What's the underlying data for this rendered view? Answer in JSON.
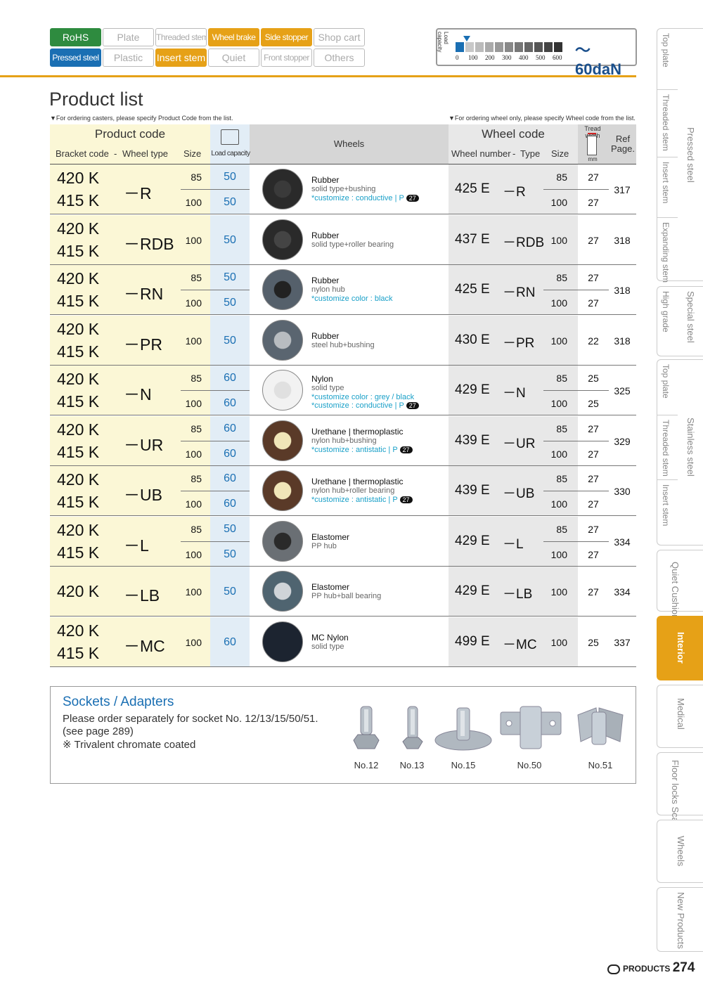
{
  "tags": {
    "row1": [
      "RoHS",
      "Plate",
      "Threaded stem",
      "Wheel brake",
      "Side stopper",
      "Shop cart"
    ],
    "row2": [
      "Pressed steel",
      "Plastic",
      "Insert stem",
      "Quiet",
      "Front stopper",
      "Others"
    ]
  },
  "load_capacity": {
    "label": "Load capacity",
    "scale_labels": [
      "0",
      "100",
      "200",
      "300",
      "400",
      "500",
      "600"
    ],
    "value": "～60daN",
    "level_daN": 60
  },
  "title": "Product list",
  "notes": {
    "left": "▼For ordering casters, please specify Product Code from the list.",
    "right": "▼For ordering wheel only, please specify Wheel code from the list."
  },
  "table_header": {
    "product_code": "Product code",
    "bracket_code": "Bracket code",
    "dash": "-",
    "wheel_type": "Wheel type",
    "size": "Size",
    "load_capacity": "Load capacity",
    "wheels": "Wheels",
    "wheel_code": "Wheel code",
    "wheel_number": "Wheel number",
    "type": "Type",
    "wsize": "Size",
    "tread_width": "Tread width",
    "mm": "mm",
    "ref_page": "Ref Page."
  },
  "rows": [
    {
      "codes": [
        "420 K",
        "415 K"
      ],
      "type": "－R",
      "sizes": [
        "85",
        "100"
      ],
      "caps": [
        "50",
        "50"
      ],
      "wname": "Rubber",
      "wsub": "solid type+bushing",
      "wcust": [
        "*customize : conductive | P"
      ],
      "badge": "27",
      "wnum": "425 E",
      "wtype": "－R",
      "wsizes": [
        "85",
        "100"
      ],
      "tws": [
        "27",
        "27"
      ],
      "ref": "317",
      "color": "#2a2a2a",
      "hub": "#3a3a3a"
    },
    {
      "codes": [
        "420 K",
        "415 K"
      ],
      "type": "－RDB",
      "sizes": [
        "100"
      ],
      "caps": [
        "50"
      ],
      "wname": "Rubber",
      "wsub": "solid type+roller bearing",
      "wcust": [],
      "badge": "",
      "wnum": "437 E",
      "wtype": "－RDB",
      "wsizes": [
        "100"
      ],
      "tws": [
        "27"
      ],
      "ref": "318",
      "color": "#2a2a2a",
      "hub": "#444"
    },
    {
      "codes": [
        "420 K",
        "415 K"
      ],
      "type": "－RN",
      "sizes": [
        "85",
        "100"
      ],
      "caps": [
        "50",
        "50"
      ],
      "wname": "Rubber",
      "wsub": "nylon hub",
      "wcust": [
        "*customize color : black"
      ],
      "badge": "",
      "wnum": "425 E",
      "wtype": "－RN",
      "wsizes": [
        "85",
        "100"
      ],
      "tws": [
        "27",
        "27"
      ],
      "ref": "318",
      "color": "#55606b",
      "hub": "#222"
    },
    {
      "codes": [
        "420 K",
        "415 K"
      ],
      "type": "－PR",
      "sizes": [
        "100"
      ],
      "caps": [
        "50"
      ],
      "wname": "Rubber",
      "wsub": "steel hub+bushing",
      "wcust": [],
      "badge": "",
      "wnum": "430 E",
      "wtype": "－PR",
      "wsizes": [
        "100"
      ],
      "tws": [
        "22"
      ],
      "ref": "318",
      "color": "#5a6570",
      "hub": "#b8bcc0"
    },
    {
      "codes": [
        "420 K",
        "415 K"
      ],
      "type": "－N",
      "sizes": [
        "85",
        "100"
      ],
      "caps": [
        "60",
        "60"
      ],
      "wname": "Nylon",
      "wsub": "solid type",
      "wcust": [
        "*customize color : grey / black",
        "*customize : conductive | P"
      ],
      "badge": "27",
      "wnum": "429 E",
      "wtype": "－N",
      "wsizes": [
        "85",
        "100"
      ],
      "tws": [
        "25",
        "25"
      ],
      "ref": "325",
      "color": "#f2f2f2",
      "hub": "#e0e0e0"
    },
    {
      "codes": [
        "420 K",
        "415 K"
      ],
      "type": "－UR",
      "sizes": [
        "85",
        "100"
      ],
      "caps": [
        "60",
        "60"
      ],
      "wname": "Urethane | thermoplastic",
      "wsub": "nylon hub+bushing",
      "wcust": [
        "*customize : antistatic | P"
      ],
      "badge": "27",
      "wnum": "439 E",
      "wtype": "－UR",
      "wsizes": [
        "85",
        "100"
      ],
      "tws": [
        "27",
        "27"
      ],
      "ref": "329",
      "color": "#5a3a28",
      "hub": "#f0e6b8"
    },
    {
      "codes": [
        "420 K",
        "415 K"
      ],
      "type": "－UB",
      "sizes": [
        "85",
        "100"
      ],
      "caps": [
        "60",
        "60"
      ],
      "wname": "Urethane | thermoplastic",
      "wsub": "nylon hub+roller bearing",
      "wcust": [
        "*customize : antistatic | P"
      ],
      "badge": "27",
      "wnum": "439 E",
      "wtype": "－UB",
      "wsizes": [
        "85",
        "100"
      ],
      "tws": [
        "27",
        "27"
      ],
      "ref": "330",
      "color": "#5a3a28",
      "hub": "#f0e6b8"
    },
    {
      "codes": [
        "420 K",
        "415 K"
      ],
      "type": "－L",
      "sizes": [
        "85",
        "100"
      ],
      "caps": [
        "50",
        "50"
      ],
      "wname": "Elastomer",
      "wsub": "PP hub",
      "wcust": [],
      "badge": "",
      "wnum": "429 E",
      "wtype": "－L",
      "wsizes": [
        "85",
        "100"
      ],
      "tws": [
        "27",
        "27"
      ],
      "ref": "334",
      "color": "#6a6f74",
      "hub": "#2a2a2a"
    },
    {
      "codes": [
        "420 K"
      ],
      "type": "－LB",
      "sizes": [
        "100"
      ],
      "caps": [
        "50"
      ],
      "wname": "Elastomer",
      "wsub": "PP hub+ball bearing",
      "wcust": [],
      "badge": "",
      "wnum": "429 E",
      "wtype": "－LB",
      "wsizes": [
        "100"
      ],
      "tws": [
        "27"
      ],
      "ref": "334",
      "color": "#4f6470",
      "hub": "#d0d4d8"
    },
    {
      "codes": [
        "420 K",
        "415 K"
      ],
      "type": "－MC",
      "sizes": [
        "100"
      ],
      "caps": [
        "60"
      ],
      "wname": "MC Nylon",
      "wsub": "solid type",
      "wcust": [],
      "badge": "",
      "wnum": "499 E",
      "wtype": "－MC",
      "wsizes": [
        "100"
      ],
      "tws": [
        "25"
      ],
      "ref": "337",
      "color": "#1c2430",
      "hub": "#1c2430"
    }
  ],
  "sockets": {
    "title": "Sockets / Adapters",
    "lines": [
      "Please order separately for socket No. 12/13/15/50/51.",
      "(see page 289)",
      "※ Trivalent chromate coated"
    ],
    "items": [
      "No.12",
      "No.13",
      "No.15",
      "No.50",
      "No.51"
    ]
  },
  "side_tabs": {
    "top_plate": "Top plate",
    "threaded_stem": "Threaded stem",
    "insert_stem": "Insert stem",
    "expanding_stem": "Expanding stem",
    "pressed_steel": "Pressed steel",
    "high_grade": "High grade",
    "special_steel": "Special steel",
    "top_plate2": "Top plate",
    "threaded_stem2": "Threaded stem",
    "insert_stem2": "Insert stem",
    "stainless_steel": "Stainless steel",
    "quiet_cushion": "Quiet Cushion",
    "interior": "Interior",
    "medical": "Medical",
    "floor_locks": "Floor locks Scaffold",
    "wheels": "Wheels",
    "new_products": "New Products"
  },
  "footer": {
    "brand": "PRODUCTS",
    "page": "274"
  }
}
